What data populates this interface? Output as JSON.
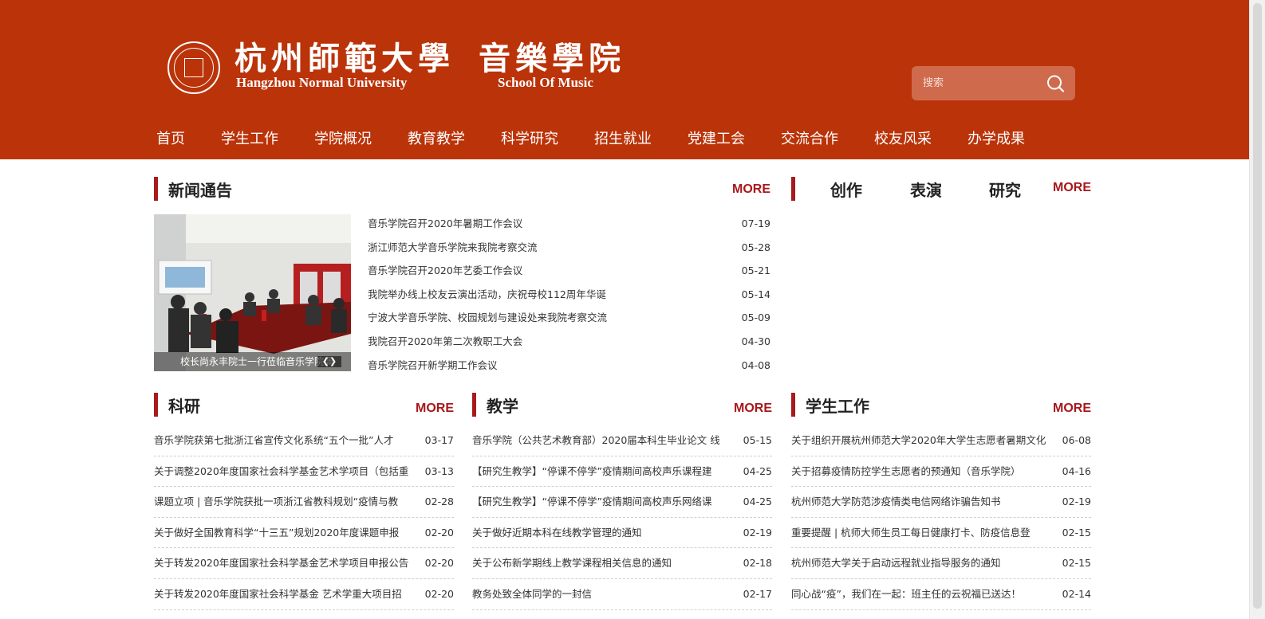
{
  "header": {
    "logo_cn_university": "杭州師範大學",
    "logo_cn_school": "音樂學院",
    "logo_en_university": "Hangzhou Normal University",
    "logo_en_school": "School Of Music",
    "search_placeholder": "搜索"
  },
  "nav": [
    "首页",
    "学生工作",
    "学院概况",
    "教育教学",
    "科学研究",
    "招生就业",
    "党建工会",
    "交流合作",
    "校友风采",
    "办学成果"
  ],
  "more_label": "MORE",
  "news": {
    "title": "新闻通告",
    "photo_caption": "校长尚永丰院士一行莅临音乐学院调",
    "slider_arrows": "❮❯",
    "items": [
      {
        "title": "音乐学院召开2020年暑期工作会议",
        "date": "07-19"
      },
      {
        "title": "浙江师范大学音乐学院来我院考察交流",
        "date": "05-28"
      },
      {
        "title": "音乐学院召开2020年艺委工作会议",
        "date": "05-21"
      },
      {
        "title": "我院举办线上校友云演出活动，庆祝母校112周年华诞",
        "date": "05-14"
      },
      {
        "title": "宁波大学音乐学院、校园规划与建设处来我院考察交流",
        "date": "05-09"
      },
      {
        "title": "我院召开2020年第二次教职工大会",
        "date": "04-30"
      },
      {
        "title": "音乐学院召开新学期工作会议",
        "date": "04-08"
      }
    ]
  },
  "tabs": [
    "创作",
    "表演",
    "研究"
  ],
  "research": {
    "title": "科研",
    "items": [
      {
        "title": "音乐学院获第七批浙江省宣传文化系统“五个一批”人才",
        "date": "03-17"
      },
      {
        "title": "关于调整2020年度国家社会科学基金艺术学项目（包括重",
        "date": "03-13"
      },
      {
        "title": "课题立项 | 音乐学院获批一项浙江省教科规划“疫情与教",
        "date": "02-28"
      },
      {
        "title": "关于做好全国教育科学“十三五”规划2020年度课题申报",
        "date": "02-20"
      },
      {
        "title": "关于转发2020年度国家社会科学基金艺术学项目申报公告",
        "date": "02-20"
      },
      {
        "title": "关于转发2020年度国家社会科学基金 艺术学重大项目招",
        "date": "02-20"
      }
    ]
  },
  "teaching": {
    "title": "教学",
    "items": [
      {
        "title": "音乐学院（公共艺术教育部）2020届本科生毕业论文 线",
        "date": "05-15"
      },
      {
        "title": "【研究生教学】“停课不停学”疫情期间高校声乐课程建",
        "date": "04-25"
      },
      {
        "title": "【研究生教学】“停课不停学”疫情期间高校声乐网络课",
        "date": "04-25"
      },
      {
        "title": "关于做好近期本科在线教学管理的通知",
        "date": "02-19"
      },
      {
        "title": "关于公布新学期线上教学课程相关信息的通知",
        "date": "02-18"
      },
      {
        "title": "教务处致全体同学的一封信",
        "date": "02-17"
      }
    ]
  },
  "student_work": {
    "title": "学生工作",
    "items": [
      {
        "title": "关于组织开展杭州师范大学2020年大学生志愿者暑期文化",
        "date": "06-08"
      },
      {
        "title": "关于招募疫情防控学生志愿者的预通知（音乐学院）",
        "date": "04-16"
      },
      {
        "title": "杭州师范大学防范涉疫情类电信网络诈骗告知书",
        "date": "02-19"
      },
      {
        "title": "重要提醒 | 杭师大师生员工每日健康打卡、防疫信息登",
        "date": "02-15"
      },
      {
        "title": "杭州师范大学关于启动远程就业指导服务的通知",
        "date": "02-15"
      },
      {
        "title": "同心战“疫”，我们在一起：班主任的云祝福已送达！",
        "date": "02-14"
      }
    ]
  },
  "colors": {
    "header_bg": "#bb3309",
    "accent": "#a61b1d",
    "more": "#a8171b"
  }
}
